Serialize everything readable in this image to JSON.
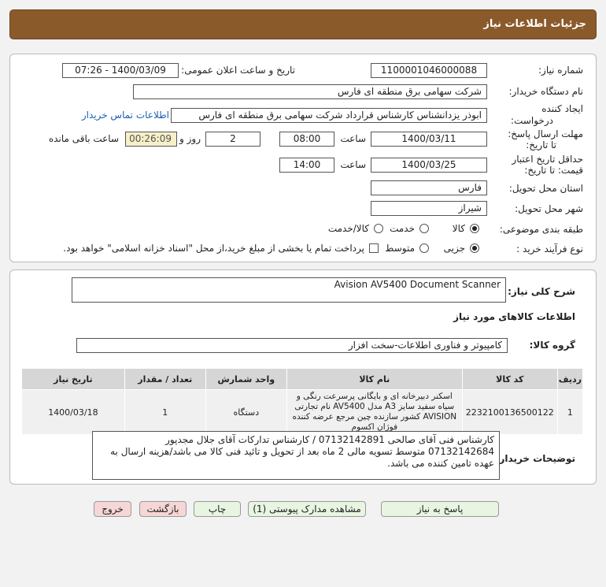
{
  "header": {
    "title": "جزئیات اطلاعات نیاز"
  },
  "form": {
    "need_number_label": "شماره نیاز:",
    "need_number": "1100001046000088",
    "announce_label": "تاریخ و ساعت اعلان عمومی:",
    "announce_value": "1400/03/09 - 07:26",
    "buyer_org_label": "نام دستگاه خریدار:",
    "buyer_org": "شرکت سهامی برق منطقه ای فارس",
    "creator_label_1": "ایجاد کننده",
    "creator_label_2": "درخواست:",
    "creator": "ابوذر  یزدانشناس کارشناس قرارداد شرکت سهامی برق منطقه ای فارس",
    "contact_link": "اطلاعات تماس خریدار",
    "reply_deadline_label_1": "مهلت ارسال پاسخ:",
    "reply_deadline_label_2": "تا تاریخ:",
    "reply_date": "1400/03/11",
    "time_label": "ساعت",
    "reply_time": "08:00",
    "days_value": "2",
    "days_label": "روز و",
    "remaining_time": "00:26:09",
    "remaining_label": "ساعت باقی مانده",
    "validity_label_1": "حداقل تاریخ اعتبار",
    "validity_label_2": "قیمت: تا تاریخ:",
    "validity_date": "1400/03/25",
    "validity_time_label": "ساعت",
    "validity_time": "14:00",
    "province_label": "استان محل تحویل:",
    "province": "فارس",
    "city_label": "شهر محل تحویل:",
    "city": "شیراز",
    "category_label": "طبقه بندی موضوعی:",
    "category_options": [
      "کالا",
      "خدمت",
      "کالا/خدمت"
    ],
    "category_selected": "کالا",
    "purchase_label": "نوع فرآیند خرید :",
    "purchase_options": [
      "جزیی",
      "متوسط"
    ],
    "purchase_selected": "جزیی",
    "payment_note": "پرداخت تمام یا بخشی از مبلغ خرید،از محل \"اسناد خزانه اسلامی\" خواهد بود."
  },
  "details": {
    "summary_label": "شرح کلی نیاز:",
    "summary": "Avision AV5400 Document Scanner",
    "items_title": "اطلاعات کالاهای مورد نیاز",
    "group_label": "گروه کالا:",
    "group_value": "کامپیوتر و فناوری اطلاعات-سخت افزار",
    "table": {
      "headers": [
        "ردیف",
        "کد کالا",
        "نام کالا",
        "واحد شمارش",
        "تعداد / مقدار",
        "تاریخ نیاز"
      ],
      "rows": [
        {
          "row": "1",
          "code": "2232100136500122",
          "name": "اسکنر دبیرخانه ای و بایگانی پرسرعت رنگی و سیاه سفید سایز A3 مدل AV5400 نام تجارتی AVISION کشور سازنده چین مرجع عرضه کننده فوژان اکسوم",
          "unit": "دستگاه",
          "qty": "1",
          "date": "1400/03/18"
        }
      ]
    },
    "buyer_notes_label": "توضیحات خریدار:",
    "buyer_notes": "کارشناس فنی آقای صالحی 07132142891 / کارشناس تدارکات آقای جلال مجدپور 07132142684 متوسط تسویه مالی 2 ماه بعد از تحویل و تائید فنی کالا می باشد/هزینه ارسال به عهده تامین کننده می باشد."
  },
  "buttons": {
    "reply": "پاسخ به نیاز",
    "attachments": "مشاهده مدارک پیوستی (1)",
    "print": "چاپ",
    "back": "بازگشت",
    "exit": "خروج"
  }
}
